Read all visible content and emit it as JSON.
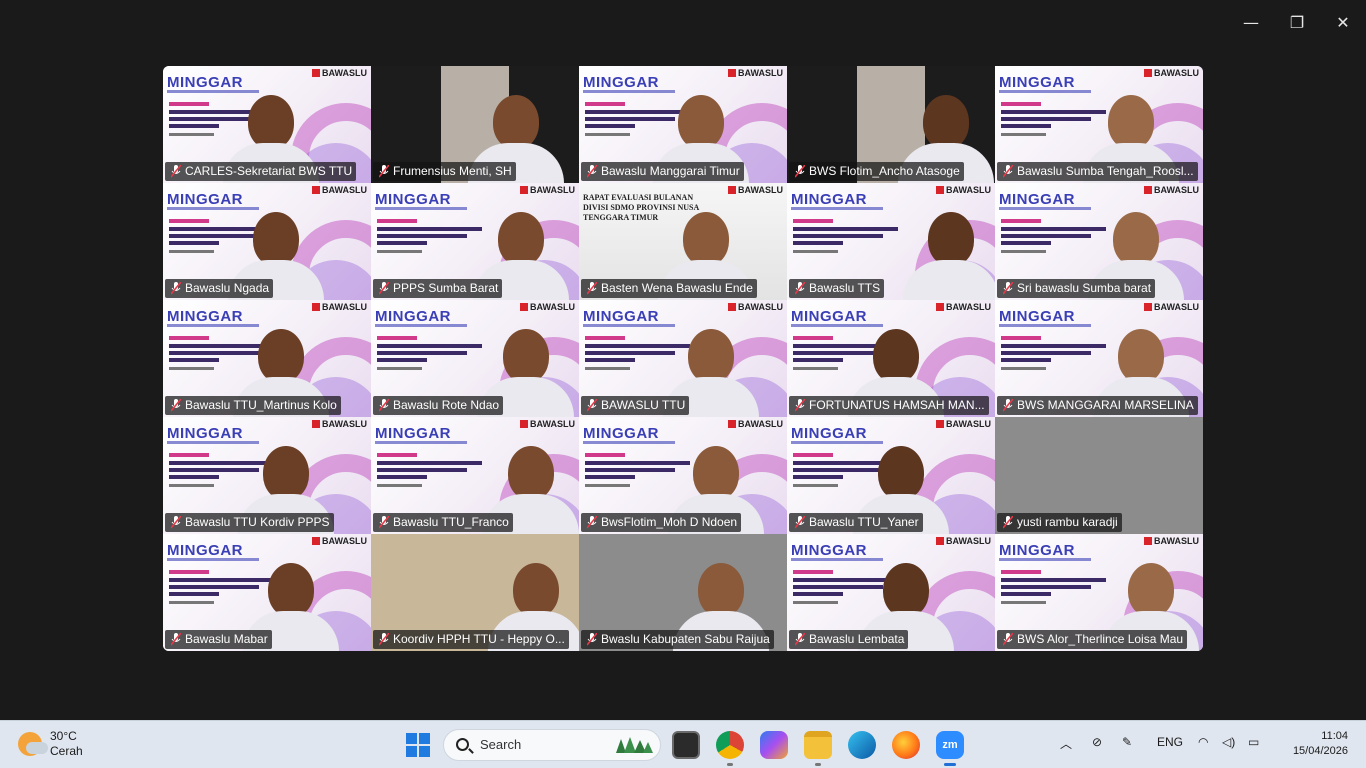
{
  "window": {
    "minimize": "—",
    "maximize": "❐",
    "close": "✕"
  },
  "slide": {
    "logo": "MINGGAR",
    "brand": "BAWASLU",
    "alt_title": "RAPAT EVALUASI BULANAN DIVISI SDMO PROVINSI NUSA TENGGARA TIMUR"
  },
  "participants": [
    {
      "name": "CARLES-Sekretariat BWS TTU",
      "variant": "slide"
    },
    {
      "name": "Frumensius Menti, SH",
      "variant": "dark",
      "active": true
    },
    {
      "name": "Bawaslu Manggarai Timur",
      "variant": "slide"
    },
    {
      "name": "BWS Flotim_Ancho Atasoge",
      "variant": "dark"
    },
    {
      "name": "Bawaslu Sumba Tengah_Roosl...",
      "variant": "slide"
    },
    {
      "name": "Bawaslu Ngada",
      "variant": "slide"
    },
    {
      "name": "PPPS Sumba Barat",
      "variant": "slide"
    },
    {
      "name": "Basten Wena Bawaslu Ende",
      "variant": "rapat"
    },
    {
      "name": "Bawaslu TTS",
      "variant": "slide"
    },
    {
      "name": "Sri bawaslu Sumba barat",
      "variant": "slide"
    },
    {
      "name": "Bawaslu TTU_Martinus Kolo",
      "variant": "slide"
    },
    {
      "name": "Bawaslu Rote Ndao",
      "variant": "slide"
    },
    {
      "name": "BAWASLU TTU",
      "variant": "slide"
    },
    {
      "name": "FORTUNATUS HAMSAH MAN...",
      "variant": "slide"
    },
    {
      "name": "BWS MANGGARAI MARSELINA",
      "variant": "slide"
    },
    {
      "name": "Bawaslu TTU Kordiv PPPS",
      "variant": "slide"
    },
    {
      "name": "Bawaslu TTU_Franco",
      "variant": "slide"
    },
    {
      "name": "BwsFlotim_Moh D Ndoen",
      "variant": "slide"
    },
    {
      "name": "Bawaslu TTU_Yaner",
      "variant": "slide"
    },
    {
      "name": "yusti rambu karadji",
      "variant": "room"
    },
    {
      "name": "Bawaslu Mabar",
      "variant": "slide"
    },
    {
      "name": "Koordiv HPPH TTU - Heppy O...",
      "variant": "room"
    },
    {
      "name": "Bwaslu Kabupaten Sabu Raijua",
      "variant": "room"
    },
    {
      "name": "Bawaslu Lembata",
      "variant": "slide"
    },
    {
      "name": "BWS Alor_Therlince Loisa Mau",
      "variant": "slide"
    }
  ],
  "taskbar": {
    "weather_temp": "30°C",
    "weather_desc": "Cerah",
    "search_placeholder": "Search",
    "language": "ENG",
    "time": "11:04",
    "date": "15/04/2026",
    "apps": [
      "file-explorer-icon",
      "chrome-icon",
      "copilot-icon",
      "folder-icon",
      "edge-icon",
      "firefox-icon",
      "zoom-icon"
    ]
  },
  "colors": {
    "active_border": "#2ad45a",
    "slide_accent": "#c45fc4",
    "logo_blue": "#3a3fb6"
  }
}
